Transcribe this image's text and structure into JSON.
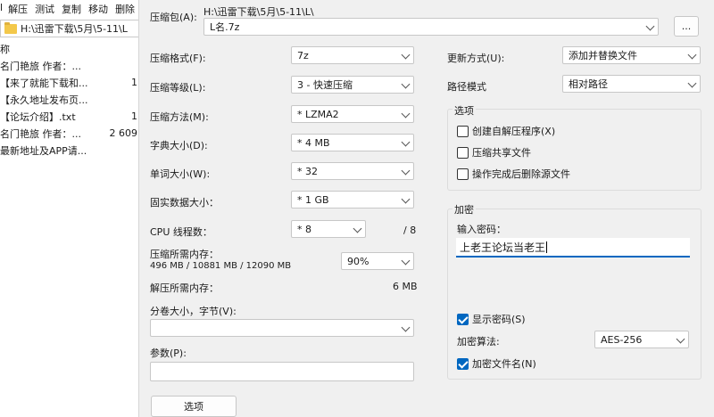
{
  "background": {
    "menu": [
      "解压",
      "测试",
      "复制",
      "移动",
      "删除"
    ],
    "menu_truncated_prefix": "l",
    "path": "H:\\迅雷下载\\5月\\5-11\\L",
    "name_header": "称",
    "files": [
      {
        "name": "名门艳旅 作者：...",
        "size": ""
      },
      {
        "name": "【来了就能下载和...",
        "size": "1"
      },
      {
        "name": "【永久地址发布页...",
        "size": ""
      },
      {
        "name": "【论坛介绍】.txt",
        "size": "1"
      },
      {
        "name": "名门艳旅 作者：...",
        "size": "2 609"
      },
      {
        "name": "最新地址及APP请...",
        "size": ""
      }
    ]
  },
  "dialog": {
    "archive_label": "压缩包(A):",
    "archive_dir": "H:\\迅雷下载\\5月\\5-11\\L\\",
    "archive_name": "L名.7z",
    "browse_label": "...",
    "left": {
      "format_label": "压缩格式(F):",
      "format_value": "7z",
      "level_label": "压缩等级(L):",
      "level_value": "3 - 快速压缩",
      "method_label": "压缩方法(M):",
      "method_value": "* LZMA2",
      "dict_label": "字典大小(D):",
      "dict_value": "* 4 MB",
      "word_label": "单词大小(W):",
      "word_value": "* 32",
      "solid_label": "固实数据大小：",
      "solid_value": "* 1 GB",
      "cpu_label": "CPU 线程数：",
      "cpu_value": "* 8",
      "cpu_max": "/ 8",
      "mem_label": "压缩所需内存：",
      "mem_value": "496 MB / 10881 MB / 12090 MB",
      "mem_percent": "90%",
      "decomp_label": "解压所需内存：",
      "decomp_value": "6 MB",
      "split_label": "分卷大小，字节(V):",
      "params_label": "参数(P):",
      "options_button": "选项"
    },
    "right": {
      "update_label": "更新方式(U):",
      "update_value": "添加并替换文件",
      "path_label": "路径模式",
      "path_value": "相对路径",
      "options_group": "选项",
      "opt_sfx": "创建自解压程序(X)",
      "opt_shared": "压缩共享文件",
      "opt_delete": "操作完成后删除源文件",
      "encrypt_group": "加密",
      "password_label": "输入密码：",
      "password_value": "上老王论坛当老王",
      "show_password": "显示密码(S)",
      "show_password_checked": true,
      "algo_label": "加密算法:",
      "algo_value": "AES-256",
      "encrypt_names": "加密文件名(N)",
      "encrypt_names_checked": true
    }
  },
  "colors": {
    "accent": "#0067c0",
    "dialog_bg": "#f0f0f0",
    "folder": "#f3c84a"
  }
}
